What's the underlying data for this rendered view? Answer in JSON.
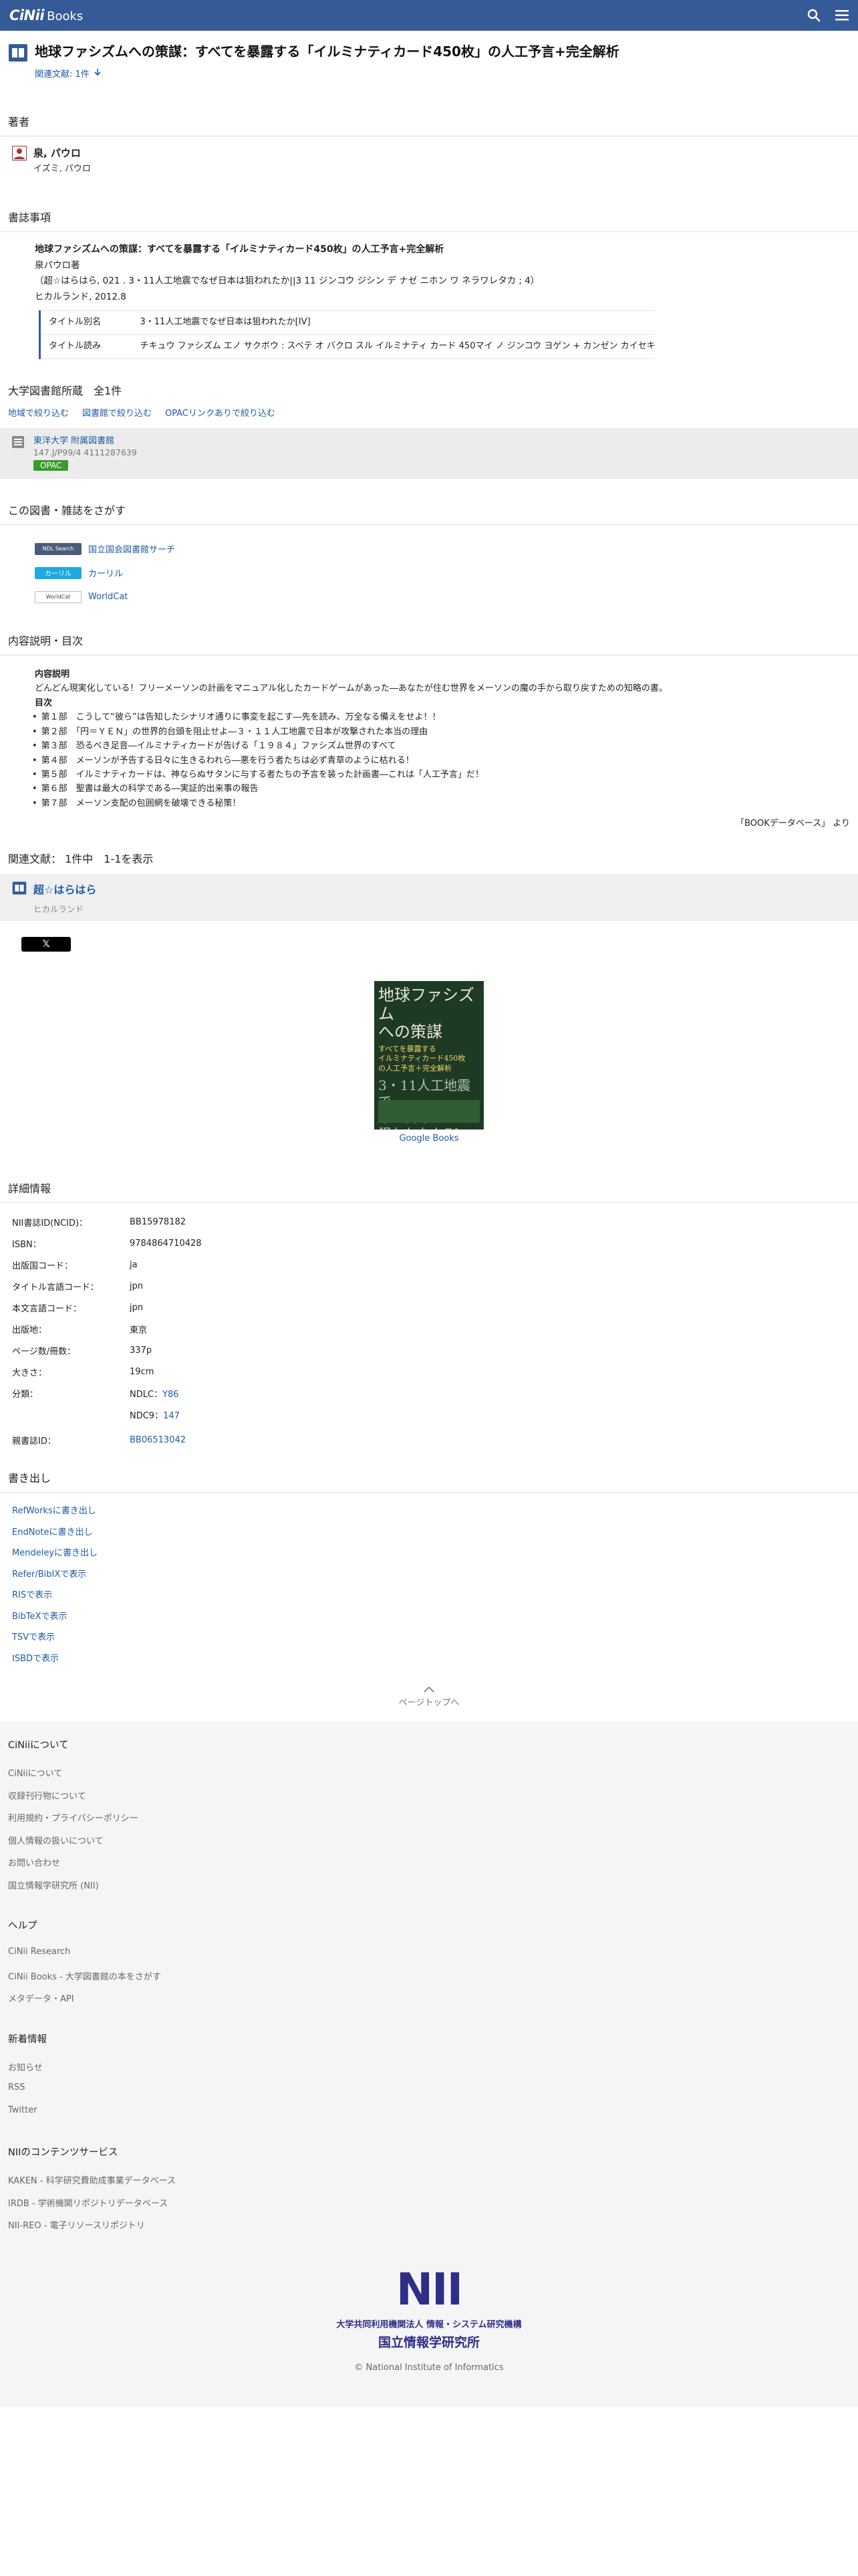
{
  "header": {
    "logo_main": "CiNii",
    "logo_sub": "Books"
  },
  "title": "地球ファシズムへの策謀：すべてを暴露する「イルミナティカード450枚」の人工予言+完全解析",
  "related_link": "関連文献: 1件",
  "author_section": {
    "heading": "著者",
    "name": "泉, パウロ",
    "kana": "イズミ, パウロ"
  },
  "biblio": {
    "heading": "書誌事項",
    "title": "地球ファシズムへの策謀：すべてを暴露する「イルミナティカード450枚」の人工予言+完全解析",
    "author_line": "泉パウロ著",
    "series_line": "（超☆はらはら, 021 . 3・11人工地震でなぜ日本は狙われたか||3 11 ジンコウ ジシン デ ナゼ ニホン ワ ネラワレタカ ; 4）",
    "publisher_line": "ヒカルランド, 2012.8",
    "alt_titles": [
      {
        "key": "タイトル別名",
        "value": "3・11人工地震でなぜ日本は狙われたか[IV]"
      },
      {
        "key": "タイトル読み",
        "value": "チキュウ ファシズム エノ サクボウ : スベテ オ バクロ スル イルミナティ カード 450マイ ノ ジンコウ ヨゲン + カンゼン カイセキ"
      }
    ]
  },
  "holdings": {
    "heading": "大学図書館所蔵　全1件",
    "filters": [
      "地域で絞り込む",
      "図書館で絞り込む",
      "OPACリンクありで絞り込む"
    ],
    "library_name": "東洋大学 附属図書館",
    "library_code": "147.J/P99/4  4111287639",
    "opac_label": "OPAC"
  },
  "search_section": {
    "heading": "この図書・雑誌をさがす",
    "items": [
      {
        "logo": "NDL Search",
        "label": "国立国会図書館サーチ"
      },
      {
        "logo": "カーリル",
        "label": "カーリル"
      },
      {
        "logo": "WorldCat",
        "label": "WorldCat"
      }
    ]
  },
  "description": {
    "heading": "内容説明・目次",
    "desc_h": "内容説明",
    "desc_text": "どんどん現実化している！フリーメーソンの計画をマニュアル化したカードゲームがあった―あなたが住む世界をメーソンの魔の手から取り戻すための知略の書。",
    "toc_h": "目次",
    "toc": [
      "第１部　こうして“彼ら”は告知したシナリオ通りに事変を起こす―先を読み、万全なる備えをせよ！！",
      "第２部　「円＝ＹＥＮ」の世界的台頭を阻止せよ―３・１１人工地震で日本が攻撃された本当の理由",
      "第３部　恐るべき足音―イルミナティカードが告げる「１９８４」ファシズム世界のすべて",
      "第４部　メーソンが予告する日々に生きるわれら―悪を行う者たちは必ず青草のように枯れる！",
      "第５部　イルミナティカードは、神ならぬサタンに与する者たちの予言を装った計画書―これは「人工予言」だ！",
      "第６部　聖書は最大の科学である―実証的出来事の報告",
      "第７部　メーソン支配の包囲網を破壊できる秘策！"
    ],
    "source": "「BOOKデータベース」 より"
  },
  "related": {
    "heading": "関連文献：  1件中　1-1を表示",
    "title": "超☆はらはら",
    "publisher": "ヒカルランド"
  },
  "share": {
    "x_label": "𝕏"
  },
  "cover": {
    "line1": "地球ファシズム\nへの策謀",
    "line2": "すべてを暴露する\nイルミナティカード450枚\nの人工予言＋完全解析",
    "line3": "3・11人工地震で\nなぜ日本は\n狙われたかⅣ",
    "google_books": "Google Books"
  },
  "details": {
    "heading": "詳細情報",
    "rows": [
      {
        "key": "NII書誌ID(NCID)：",
        "value": "BB15978182",
        "link": false
      },
      {
        "key": "ISBN：",
        "value": "9784864710428",
        "link": false
      },
      {
        "key": "出版国コード：",
        "value": "ja",
        "link": false
      },
      {
        "key": "タイトル言語コード：",
        "value": "jpn",
        "link": false
      },
      {
        "key": "本文言語コード：",
        "value": "jpn",
        "link": false
      },
      {
        "key": "出版地：",
        "value": "東京",
        "link": false
      },
      {
        "key": "ページ数/冊数：",
        "value": "337p",
        "link": false
      },
      {
        "key": "大きさ：",
        "value": "19cm",
        "link": false
      }
    ],
    "class_key": "分類：",
    "ndlc_prefix": "NDLC：",
    "ndlc_value": "Y86",
    "ndc9_prefix": "NDC9：",
    "ndc9_value": "147",
    "parent_key": "親書誌ID：",
    "parent_value": "BB06513042"
  },
  "export": {
    "heading": "書き出し",
    "items": [
      "RefWorksに書き出し",
      "EndNoteに書き出し",
      "Mendeleyに書き出し",
      "Refer/BibIXで表示",
      "RISで表示",
      "BibTeXで表示",
      "TSVで表示",
      "ISBDで表示"
    ]
  },
  "pagetop": "ページトップへ",
  "footer": {
    "groups": [
      {
        "heading": "CiNiiについて",
        "items": [
          "CiNiiについて",
          "収録刊行物について",
          "利用規約・プライバシーポリシー",
          "個人情報の扱いについて",
          "お問い合わせ",
          "国立情報学研究所 (NII)"
        ]
      },
      {
        "heading": "ヘルプ",
        "items": [
          "CiNii Research",
          "CiNii Books - 大学図書館の本をさがす",
          "メタデータ・API"
        ]
      },
      {
        "heading": "新着情報",
        "items": [
          "お知らせ",
          "RSS",
          "Twitter"
        ]
      },
      {
        "heading": "NIIのコンテンツサービス",
        "items": [
          "KAKEN - 科学研究費助成事業データベース",
          "IRDB - 学術機関リポジトリデータベース",
          "NII-REO - 電子リソースリポジトリ"
        ]
      }
    ],
    "nii_logo": "NII",
    "nii_sub1": "大学共同利用機関法人 情報・システム研究機構",
    "nii_sub2": "国立情報学研究所",
    "copyright": "© National Institute of Informatics"
  }
}
